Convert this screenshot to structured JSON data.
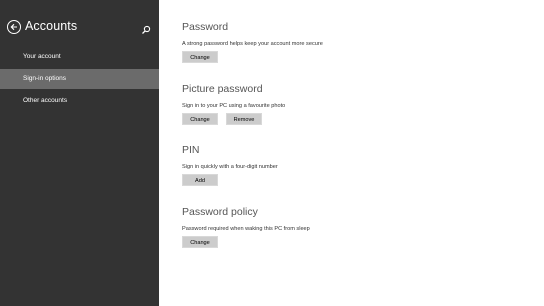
{
  "sidebar": {
    "title": "Accounts",
    "items": [
      {
        "label": "Your account"
      },
      {
        "label": "Sign-in options"
      },
      {
        "label": "Other accounts"
      }
    ]
  },
  "sections": {
    "password": {
      "heading": "Password",
      "description": "A strong password helps keep your account more secure",
      "change_label": "Change"
    },
    "picture_password": {
      "heading": "Picture password",
      "description": "Sign in to your PC using a favourite photo",
      "change_label": "Change",
      "remove_label": "Remove"
    },
    "pin": {
      "heading": "PIN",
      "description": "Sign in quickly with a four-digit number",
      "add_label": "Add"
    },
    "password_policy": {
      "heading": "Password policy",
      "description": "Password required when waking this PC from sleep",
      "change_label": "Change"
    }
  },
  "colors": {
    "sidebar_bg": "#333333",
    "selected_item_bg": "#6b6b6b",
    "button_bg": "#cccccc"
  }
}
